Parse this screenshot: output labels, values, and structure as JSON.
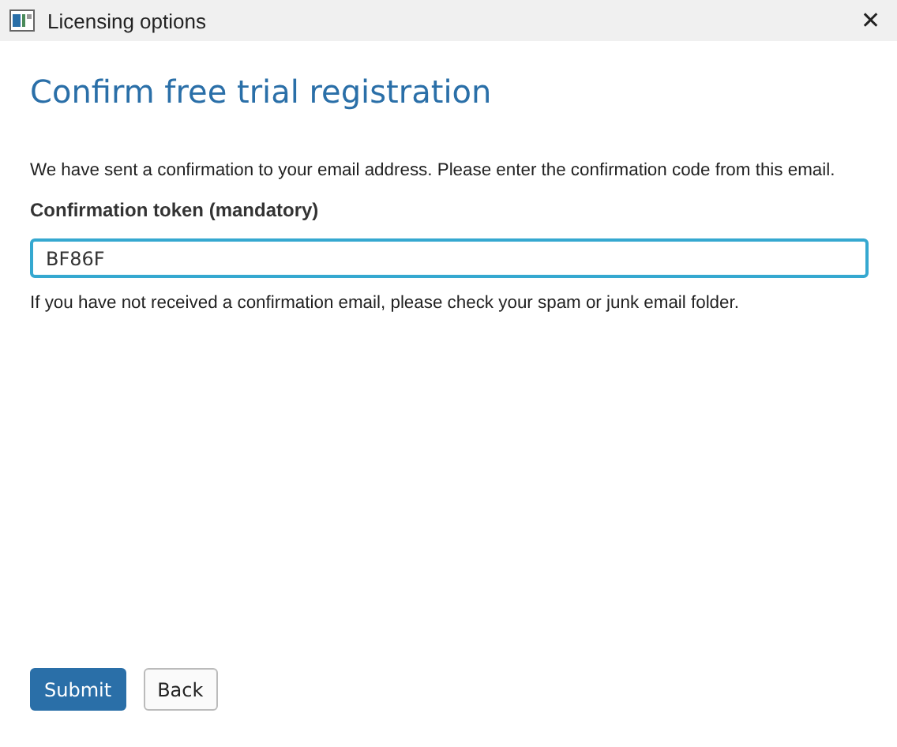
{
  "window": {
    "title": "Licensing options",
    "close": "✕"
  },
  "heading": "Confirm free trial registration",
  "intro": "We have sent a confirmation to your email address. Please enter the confirmation code from this email.",
  "field": {
    "label": "Confirmation token (mandatory)",
    "value": "BF86F",
    "focused": true
  },
  "hint": "If you have not received a confirmation email, please check your spam or junk email folder.",
  "buttons": [
    {
      "label": "Submit",
      "kind": "primary"
    },
    {
      "label": "Back",
      "kind": "secondary"
    }
  ]
}
